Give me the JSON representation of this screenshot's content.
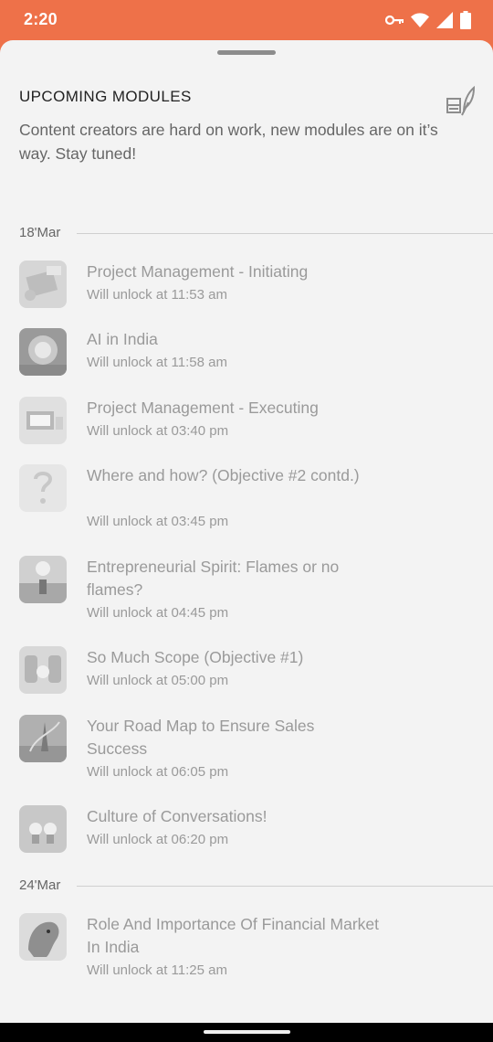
{
  "status_bar": {
    "time": "2:20",
    "icons": [
      "key-icon",
      "wifi-icon",
      "signal-icon",
      "battery-icon"
    ],
    "color": "#ee7149"
  },
  "sheet": {
    "title": "UPCOMING MODULES",
    "subtitle": "Content creators are hard on work, new modules are on it’s way. Stay tuned!",
    "header_icon": "books-feather-icon",
    "background": "#f3f3f3"
  },
  "groups": [
    {
      "date": "18'Mar",
      "modules": [
        {
          "title": "Project Management - Initiating",
          "unlock": "Will unlock at 11:53 am"
        },
        {
          "title": "AI in India",
          "unlock": "Will unlock at 11:58 am"
        },
        {
          "title": "Project Management - Executing",
          "unlock": "Will unlock at 03:40 pm"
        },
        {
          "title": "Where and how? (Objective #2 contd.)",
          "unlock": "Will unlock at 03:45 pm"
        },
        {
          "title": "Entrepreneurial Spirit: Flames or no flames?",
          "unlock": "Will unlock at 04:45 pm"
        },
        {
          "title": "So Much Scope (Objective #1)",
          "unlock": "Will unlock at 05:00 pm"
        },
        {
          "title": "Your Road Map to Ensure Sales Success",
          "unlock": "Will unlock at 06:05 pm"
        },
        {
          "title": "Culture of Conversations!",
          "unlock": "Will unlock at 06:20 pm"
        }
      ]
    },
    {
      "date": "24'Mar",
      "modules": [
        {
          "title": "Role And Importance Of Financial Market In India",
          "unlock": "Will unlock at 11:25 am"
        }
      ]
    }
  ]
}
